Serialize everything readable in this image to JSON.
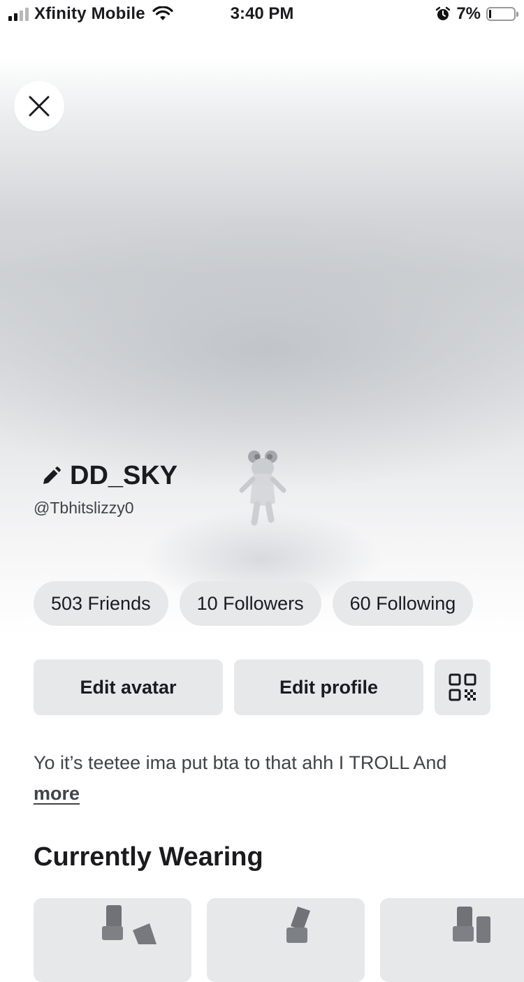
{
  "status_bar": {
    "carrier": "Xfinity Mobile",
    "time": "3:40 PM",
    "battery_percent": "7%",
    "icons": [
      "signal-icon",
      "wifi-icon",
      "alarm-icon",
      "battery-icon"
    ]
  },
  "profile": {
    "display_name": "DD_SKY",
    "username": "@Tbhitslizzy0"
  },
  "stats": {
    "friends": "503 Friends",
    "followers": "10 Followers",
    "following": "60 Following"
  },
  "actions": {
    "edit_avatar": "Edit avatar",
    "edit_profile": "Edit profile",
    "qr_icon": "qr-code-icon"
  },
  "bio": {
    "text": "Yo it’s teetee ima put bta to that ahh I TROLL And",
    "more": "more"
  },
  "currently_wearing": {
    "title": "Currently Wearing",
    "item_count_visible": 3
  },
  "colors": {
    "pill_background": "#e7e8ea",
    "text_primary": "#1b1b1f",
    "text_secondary": "#404347"
  }
}
